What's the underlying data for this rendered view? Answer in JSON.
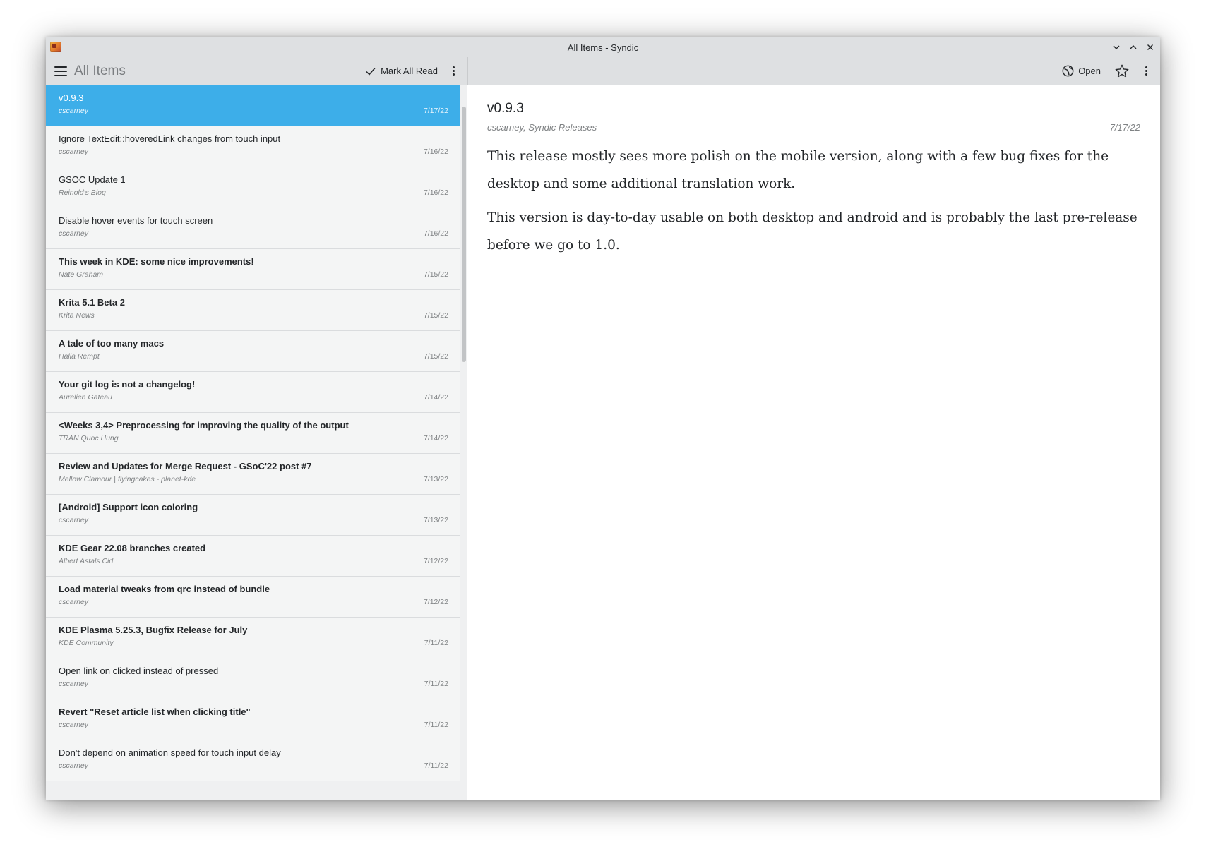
{
  "window": {
    "title": "All Items - Syndic"
  },
  "toolbar": {
    "heading": "All Items",
    "mark_all_read_label": "Mark All Read",
    "open_label": "Open"
  },
  "items": [
    {
      "title": "v0.9.3",
      "source": "cscarney",
      "date": "7/17/22",
      "unread": false,
      "selected": true
    },
    {
      "title": "Ignore TextEdit::hoveredLink changes from touch input",
      "source": "cscarney",
      "date": "7/16/22",
      "unread": false,
      "selected": false
    },
    {
      "title": "GSOC Update 1",
      "source": "Reinold's Blog",
      "date": "7/16/22",
      "unread": false,
      "selected": false
    },
    {
      "title": "Disable hover events for touch screen",
      "source": "cscarney",
      "date": "7/16/22",
      "unread": false,
      "selected": false
    },
    {
      "title": "This week in KDE: some nice improvements!",
      "source": "Nate Graham",
      "date": "7/15/22",
      "unread": true,
      "selected": false
    },
    {
      "title": "Krita 5.1 Beta 2",
      "source": "Krita News",
      "date": "7/15/22",
      "unread": true,
      "selected": false
    },
    {
      "title": "A tale of too many macs",
      "source": "Halla Rempt",
      "date": "7/15/22",
      "unread": true,
      "selected": false
    },
    {
      "title": "Your git log is not a changelog!",
      "source": "Aurelien Gateau",
      "date": "7/14/22",
      "unread": true,
      "selected": false
    },
    {
      "title": "<Weeks 3,4> Preprocessing for improving the quality of the output",
      "source": "TRAN Quoc Hung",
      "date": "7/14/22",
      "unread": true,
      "selected": false
    },
    {
      "title": "Review and Updates for Merge Request - GSoC'22 post #7",
      "source": "Mellow Clamour | flyingcakes - planet-kde",
      "date": "7/13/22",
      "unread": true,
      "selected": false
    },
    {
      "title": "[Android] Support icon coloring",
      "source": "cscarney",
      "date": "7/13/22",
      "unread": true,
      "selected": false
    },
    {
      "title": "KDE Gear 22.08 branches created",
      "source": "Albert Astals Cid",
      "date": "7/12/22",
      "unread": true,
      "selected": false
    },
    {
      "title": "Load material tweaks from qrc instead of bundle",
      "source": "cscarney",
      "date": "7/12/22",
      "unread": true,
      "selected": false
    },
    {
      "title": "KDE Plasma 5.25.3, Bugfix Release for July",
      "source": "KDE Community",
      "date": "7/11/22",
      "unread": true,
      "selected": false
    },
    {
      "title": "Open link on clicked instead of pressed",
      "source": "cscarney",
      "date": "7/11/22",
      "unread": false,
      "selected": false
    },
    {
      "title": "Revert \"Reset article list when clicking title\"",
      "source": "cscarney",
      "date": "7/11/22",
      "unread": true,
      "selected": false
    },
    {
      "title": "Don't depend on animation speed for touch input delay",
      "source": "cscarney",
      "date": "7/11/22",
      "unread": false,
      "selected": false
    }
  ],
  "article": {
    "title": "v0.9.3",
    "byline": "cscarney, Syndic Releases",
    "date": "7/17/22",
    "paragraphs": [
      "This release mostly sees more polish on the mobile version, along with a few bug fixes for the desktop and some additional translation work.",
      "This version is day-to-day usable on both desktop and android and is probably the last pre-release before we go to 1.0."
    ]
  },
  "colors": {
    "accent": "#3daee9",
    "window_bg": "#eff0f1",
    "toolbar_bg": "#dee0e2",
    "text": "#232629",
    "muted_text": "#7f8284"
  },
  "icons": {
    "app": "syndic-app-icon",
    "menu": "hamburger-icon",
    "mark_read": "checkmark-icon",
    "overflow": "kebab-icon",
    "open": "globe-icon",
    "star": "star-icon",
    "minimize": "chevron-down-icon",
    "maximize": "chevron-up-icon",
    "close": "close-icon"
  }
}
